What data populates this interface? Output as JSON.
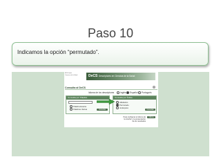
{
  "slide": {
    "title": "Paso 10",
    "instruction": "Indicamos la opción “permutado”."
  },
  "screenshot": {
    "logo_lines": [
      "BVS Salud",
      "Ciencias de la Salud"
    ],
    "banner_logo": "DeCS",
    "banner_text": "Descriptores en Ciencias de la Salud",
    "page_title": "Consulta al DeCS",
    "help_icon": "?",
    "language_label": "Idioma de los descriptores",
    "languages": [
      "Inglés",
      "Español",
      "Portugués"
    ],
    "selected_language": "Español",
    "left_box": {
      "header": "Consulta por Palabra",
      "options": [
        "Palabra Exacta",
        "Palabras Vacías"
      ],
      "button": "Consultar"
    },
    "right_box": {
      "header": "Consulta por Índice",
      "options": [
        "Alfabético",
        "Permutado",
        "Jerárquico"
      ],
      "selected_option": "Permutado",
      "button": "Consultar"
    },
    "footer_text": "Para configurar el idioma de la interfaz y la presentación de los resultados",
    "footer_button": "Idioma",
    "colors": {
      "panel_bg": "#cfe0cf",
      "banner_dark": "#3c5e3c",
      "arrow": "#3f9a3f"
    }
  }
}
